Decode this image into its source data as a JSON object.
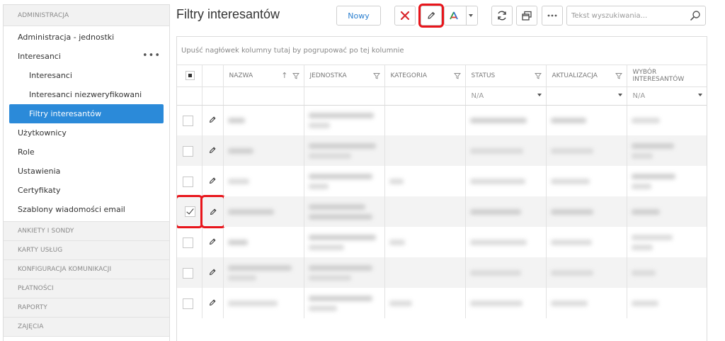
{
  "sidebar": {
    "admin_header": "ADMINISTRACJA",
    "items": [
      {
        "label": "Administracja - jednostki"
      },
      {
        "label": "Interesanci"
      },
      {
        "label": "Interesanci"
      },
      {
        "label": "Interesanci niezweryfikowani"
      },
      {
        "label": "Filtry interesantów"
      },
      {
        "label": "Użytkownicy"
      },
      {
        "label": "Role"
      },
      {
        "label": "Ustawienia"
      },
      {
        "label": "Certyfikaty"
      },
      {
        "label": "Szablony wiadomości email"
      }
    ],
    "sections": [
      {
        "label": "ANKIETY I SONDY"
      },
      {
        "label": "KARTY USŁUG"
      },
      {
        "label": "KONFIGURACJA KOMUNIKACJI"
      },
      {
        "label": "PŁATNOŚCI"
      },
      {
        "label": "RAPORTY"
      },
      {
        "label": "ZAJĘCIA"
      }
    ],
    "dots": "•••"
  },
  "header": {
    "title": "Filtry interesantów",
    "new_button": "Nowy",
    "search_placeholder": "Tekst wyszukiwania..."
  },
  "grid": {
    "group_hint": "Upuść nagłówek kolumny tutaj by pogrupować po tej kolumnie",
    "columns": [
      "NAZWA",
      "JEDNOSTKA",
      "KATEGORIA",
      "STATUS",
      "AKTUALIZACJA",
      "WYBÓR INTERESANTÓW"
    ],
    "filters": {
      "status": "N/A",
      "aktualizacja": "",
      "wybor": "N/A"
    },
    "sort_arrow": "↑",
    "rows": [
      {
        "checked": false
      },
      {
        "checked": false
      },
      {
        "checked": false
      },
      {
        "checked": true
      },
      {
        "checked": false
      },
      {
        "checked": false
      },
      {
        "checked": false
      }
    ]
  },
  "colors": {
    "accent": "#2b8ad9",
    "highlight": "#e8151b",
    "delete": "#d9262c"
  }
}
